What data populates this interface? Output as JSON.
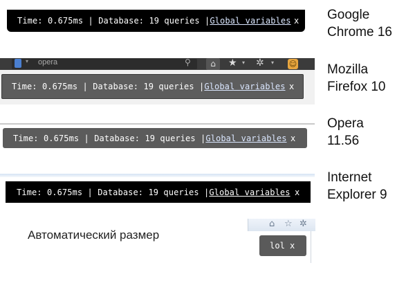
{
  "browsers": [
    {
      "name_line1": "Google",
      "name_line2": "Chrome 16"
    },
    {
      "name_line1": "Mozilla",
      "name_line2": "Firefox 10"
    },
    {
      "name_line1": "Opera",
      "name_line2": "11.56"
    },
    {
      "name_line1": "Internet",
      "name_line2": "Explorer 9"
    }
  ],
  "debug_bar": {
    "text": "Time: 0.675ms | Database: 19 queries | ",
    "link": "Global variables",
    "close": "x"
  },
  "firefox": {
    "search_value": "opera",
    "toolbar_icons": [
      "home-icon",
      "star-icon",
      "gear-icon",
      "smiley-addon-icon"
    ]
  },
  "auto_size": {
    "caption": "Автоматический размер",
    "bar_text": "lol",
    "close": "x",
    "toolbar_icons": [
      "home-icon",
      "star-icon",
      "gear-icon"
    ]
  }
}
